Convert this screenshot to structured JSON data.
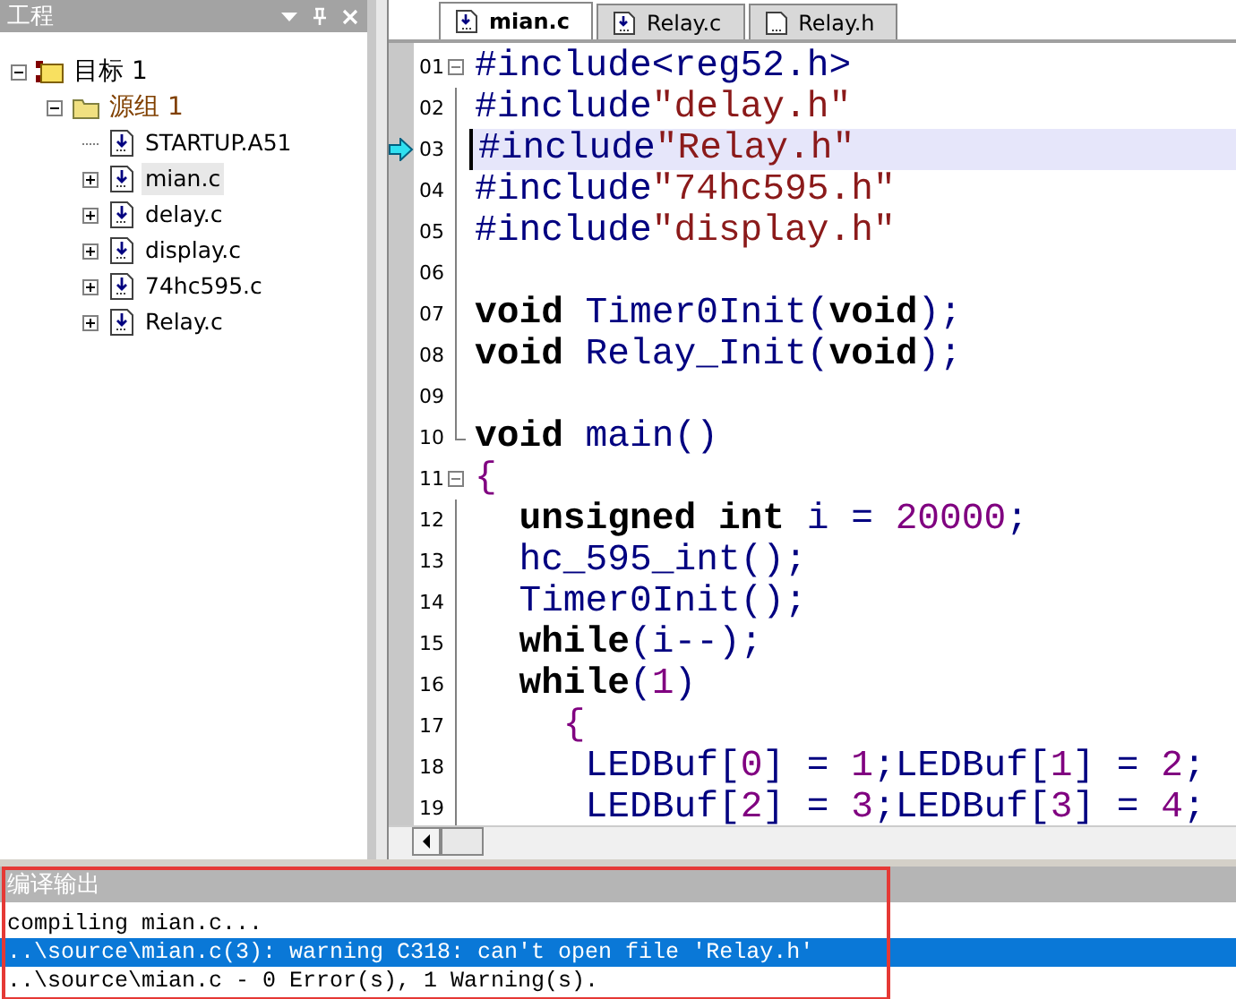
{
  "project_panel": {
    "title": "工程",
    "tree": [
      {
        "label": "目标 1",
        "kind": "target",
        "expanded": true,
        "selected": false,
        "children": [
          {
            "label": "源组 1",
            "kind": "group",
            "expanded": true,
            "selected": false,
            "children": [
              {
                "label": "STARTUP.A51",
                "kind": "leaf",
                "selected": false
              },
              {
                "label": "mian.c",
                "kind": "file",
                "expanded": false,
                "selected": true
              },
              {
                "label": "delay.c",
                "kind": "file",
                "expanded": false,
                "selected": false
              },
              {
                "label": "display.c",
                "kind": "file",
                "expanded": false,
                "selected": false
              },
              {
                "label": "74hc595.c",
                "kind": "file",
                "expanded": false,
                "selected": false
              },
              {
                "label": "Relay.c",
                "kind": "file",
                "expanded": false,
                "selected": false
              }
            ]
          }
        ]
      }
    ]
  },
  "editor": {
    "tabs": [
      {
        "label": "mian.c",
        "kind": "source",
        "selected": true
      },
      {
        "label": "Relay.c",
        "kind": "source",
        "selected": false
      },
      {
        "label": "Relay.h",
        "kind": "header",
        "selected": false
      }
    ],
    "lines": [
      {
        "number": "01",
        "kind": "foldstart",
        "current": false,
        "code": [
          {
            "kind": "pre",
            "text": "#include"
          },
          {
            "kind": "id",
            "text": "<reg52.h>"
          }
        ]
      },
      {
        "number": "02",
        "kind": "foldbody",
        "current": false,
        "code": [
          {
            "kind": "pre",
            "text": "#include"
          },
          {
            "kind": "str",
            "text": "\"delay.h\""
          }
        ]
      },
      {
        "number": "03",
        "kind": "foldbody",
        "current": true,
        "code": [
          {
            "kind": "pre",
            "text": "#include"
          },
          {
            "kind": "str",
            "text": "\"Relay.h\""
          }
        ]
      },
      {
        "number": "04",
        "kind": "foldbody",
        "current": false,
        "code": [
          {
            "kind": "pre",
            "text": "#include"
          },
          {
            "kind": "str",
            "text": "\"74hc595.h\""
          }
        ]
      },
      {
        "number": "05",
        "kind": "foldbody",
        "current": false,
        "code": [
          {
            "kind": "pre",
            "text": "#include"
          },
          {
            "kind": "str",
            "text": "\"display.h\""
          }
        ]
      },
      {
        "number": "06",
        "kind": "foldbody",
        "current": false
      },
      {
        "number": "07",
        "kind": "foldbody",
        "current": false,
        "code": [
          {
            "kind": "kw",
            "text": "void"
          },
          {
            "kind": "id",
            "text": " Timer0Init("
          },
          {
            "kind": "kw",
            "text": "void"
          },
          {
            "kind": "id",
            "text": ");"
          }
        ]
      },
      {
        "number": "08",
        "kind": "foldbody",
        "current": false,
        "code": [
          {
            "kind": "kw",
            "text": "void"
          },
          {
            "kind": "id",
            "text": " Relay_Init("
          },
          {
            "kind": "kw",
            "text": "void"
          },
          {
            "kind": "id",
            "text": ");"
          }
        ]
      },
      {
        "number": "09",
        "kind": "foldbody",
        "current": false
      },
      {
        "number": "10",
        "kind": "foldend",
        "current": false,
        "code": [
          {
            "kind": "kw",
            "text": "void"
          },
          {
            "kind": "id",
            "text": " main()"
          }
        ]
      },
      {
        "number": "11",
        "kind": "foldstart",
        "current": false,
        "code": [
          {
            "kind": "num",
            "text": "{"
          }
        ]
      },
      {
        "number": "12",
        "kind": "foldbody",
        "current": false,
        "code": [
          {
            "kind": "kw",
            "text": "  unsigned int"
          },
          {
            "kind": "id",
            "text": " i = "
          },
          {
            "kind": "num",
            "text": "20000"
          },
          {
            "kind": "id",
            "text": ";"
          }
        ]
      },
      {
        "number": "13",
        "kind": "foldbody",
        "current": false,
        "code": [
          {
            "kind": "id",
            "text": "  hc_595_int();"
          }
        ]
      },
      {
        "number": "14",
        "kind": "foldbody",
        "current": false,
        "code": [
          {
            "kind": "id",
            "text": "  Timer0Init();"
          }
        ]
      },
      {
        "number": "15",
        "kind": "foldbody",
        "current": false,
        "code": [
          {
            "kind": "kw",
            "text": "  while"
          },
          {
            "kind": "id",
            "text": "(i--);"
          }
        ]
      },
      {
        "number": "16",
        "kind": "foldbody",
        "current": false,
        "code": [
          {
            "kind": "kw",
            "text": "  while"
          },
          {
            "kind": "id",
            "text": "("
          },
          {
            "kind": "num",
            "text": "1"
          },
          {
            "kind": "id",
            "text": ")"
          }
        ]
      },
      {
        "number": "17",
        "kind": "foldbody",
        "current": false,
        "code": [
          {
            "kind": "num",
            "text": "    {"
          }
        ]
      },
      {
        "number": "18",
        "kind": "foldbody",
        "current": false,
        "code": [
          {
            "kind": "id",
            "text": "     LEDBuf["
          },
          {
            "kind": "num",
            "text": "0"
          },
          {
            "kind": "id",
            "text": "] = "
          },
          {
            "kind": "num",
            "text": "1"
          },
          {
            "kind": "id",
            "text": ";LEDBuf["
          },
          {
            "kind": "num",
            "text": "1"
          },
          {
            "kind": "id",
            "text": "] = "
          },
          {
            "kind": "num",
            "text": "2"
          },
          {
            "kind": "id",
            "text": ";"
          }
        ]
      },
      {
        "number": "19",
        "kind": "foldbody",
        "current": false,
        "code": [
          {
            "kind": "id",
            "text": "     LEDBuf["
          },
          {
            "kind": "num",
            "text": "2"
          },
          {
            "kind": "id",
            "text": "] = "
          },
          {
            "kind": "num",
            "text": "3"
          },
          {
            "kind": "id",
            "text": ";LEDBuf["
          },
          {
            "kind": "num",
            "text": "3"
          },
          {
            "kind": "id",
            "text": "] = "
          },
          {
            "kind": "num",
            "text": "4"
          },
          {
            "kind": "id",
            "text": ";"
          }
        ]
      }
    ]
  },
  "output": {
    "title": "编译输出",
    "marked": true,
    "lines": [
      {
        "text": "compiling mian.c...",
        "selected": false
      },
      {
        "text": "..\\source\\mian.c(3): warning C318: can't open file 'Relay.h'",
        "selected": true
      },
      {
        "text": "..\\source\\mian.c - 0 Error(s), 1 Warning(s).",
        "selected": false
      }
    ]
  }
}
